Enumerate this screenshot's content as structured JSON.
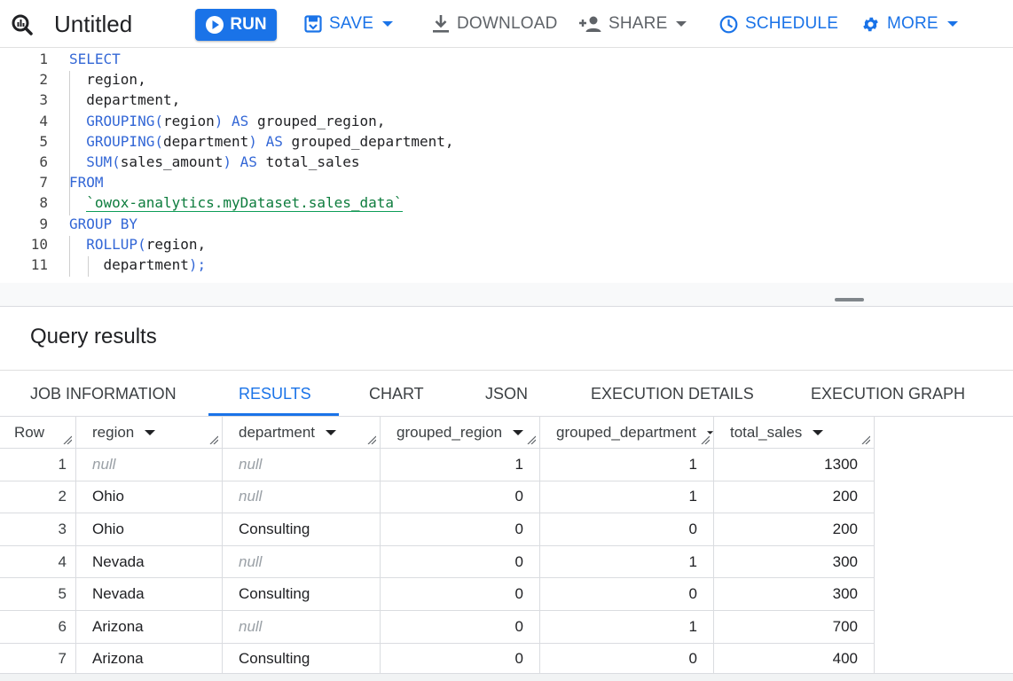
{
  "toolbar": {
    "title": "Untitled",
    "run_label": "RUN",
    "save_label": "SAVE",
    "download_label": "DOWNLOAD",
    "share_label": "SHARE",
    "schedule_label": "SCHEDULE",
    "more_label": "MORE",
    "accent_color": "#1a73e8"
  },
  "editor": {
    "line_numbers": [
      "1",
      "2",
      "3",
      "4",
      "5",
      "6",
      "7",
      "8",
      "9",
      "10",
      "11"
    ],
    "lines": [
      [
        {
          "t": "SELECT",
          "k": "kw"
        }
      ],
      [
        {
          "t": "  region,",
          "k": ""
        }
      ],
      [
        {
          "t": "  department,",
          "k": ""
        }
      ],
      [
        {
          "t": "  ",
          "k": ""
        },
        {
          "t": "GROUPING(",
          "k": "kw"
        },
        {
          "t": "region",
          "k": ""
        },
        {
          "t": ")",
          "k": "kw"
        },
        {
          "t": " ",
          "k": ""
        },
        {
          "t": "AS",
          "k": "kw"
        },
        {
          "t": " grouped_region,",
          "k": ""
        }
      ],
      [
        {
          "t": "  ",
          "k": ""
        },
        {
          "t": "GROUPING(",
          "k": "kw"
        },
        {
          "t": "department",
          "k": ""
        },
        {
          "t": ")",
          "k": "kw"
        },
        {
          "t": " ",
          "k": ""
        },
        {
          "t": "AS",
          "k": "kw"
        },
        {
          "t": " grouped_department,",
          "k": ""
        }
      ],
      [
        {
          "t": "  ",
          "k": ""
        },
        {
          "t": "SUM(",
          "k": "kw"
        },
        {
          "t": "sales_amount",
          "k": ""
        },
        {
          "t": ")",
          "k": "kw"
        },
        {
          "t": " ",
          "k": ""
        },
        {
          "t": "AS",
          "k": "kw"
        },
        {
          "t": " total_sales",
          "k": ""
        }
      ],
      [
        {
          "t": "FROM",
          "k": "kw"
        }
      ],
      [
        {
          "t": "  ",
          "k": ""
        },
        {
          "t": "`owox-analytics.myDataset.sales_data`",
          "k": "str"
        }
      ],
      [
        {
          "t": "GROUP BY",
          "k": "kw"
        }
      ],
      [
        {
          "t": "  ",
          "k": ""
        },
        {
          "t": "ROLLUP(",
          "k": "kw"
        },
        {
          "t": "region,",
          "k": ""
        }
      ],
      [
        {
          "t": "    department",
          "k": ""
        },
        {
          "t": ");",
          "k": "kw"
        }
      ]
    ]
  },
  "results": {
    "title": "Query results",
    "tabs": [
      "JOB INFORMATION",
      "RESULTS",
      "CHART",
      "JSON",
      "EXECUTION DETAILS",
      "EXECUTION GRAPH"
    ],
    "active_tab": "RESULTS",
    "columns": [
      "Row",
      "region",
      "department",
      "grouped_region",
      "grouped_department",
      "total_sales"
    ],
    "rows": [
      [
        "1",
        "null",
        "null",
        "1",
        "1",
        "1300"
      ],
      [
        "2",
        "Ohio",
        "null",
        "0",
        "1",
        "200"
      ],
      [
        "3",
        "Ohio",
        "Consulting",
        "0",
        "0",
        "200"
      ],
      [
        "4",
        "Nevada",
        "null",
        "0",
        "1",
        "300"
      ],
      [
        "5",
        "Nevada",
        "Consulting",
        "0",
        "0",
        "300"
      ],
      [
        "6",
        "Arizona",
        "null",
        "0",
        "1",
        "700"
      ],
      [
        "7",
        "Arizona",
        "Consulting",
        "0",
        "0",
        "400"
      ]
    ]
  }
}
